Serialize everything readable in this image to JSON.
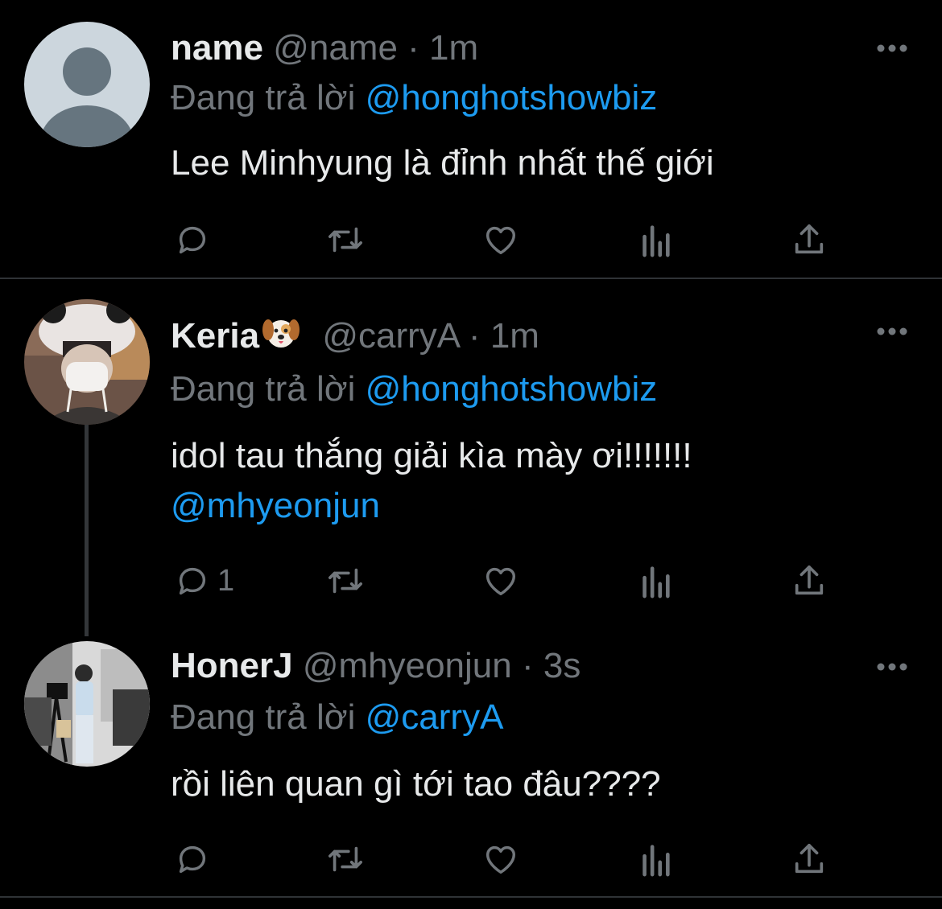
{
  "tweets": [
    {
      "name": "name",
      "handle": "@name",
      "time": "1m",
      "replying_label": "Đang trả lời",
      "replying_to": "@honghotshowbiz",
      "text": "Lee Minhyung là đỉnh nhất thế giới",
      "reply_count": ""
    },
    {
      "name": "Keria",
      "emoji": "dog-face-emoji",
      "handle": "@carryA",
      "time": "1m",
      "replying_label": "Đang trả lời",
      "replying_to": "@honghotshowbiz",
      "text": "idol tau thắng giải kìa mày ơi!!!!!!!",
      "text_mention": "@mhyeonjun",
      "reply_count": "1"
    },
    {
      "name": "HonerJ",
      "handle": "@mhyeonjun",
      "time": "3s",
      "replying_label": "Đang trả lời",
      "replying_to": "@carryA",
      "text": "rồi liên quan gì tới tao đâu????",
      "reply_count": ""
    }
  ],
  "separator": "·",
  "colors": {
    "background": "#000000",
    "text": "#e7e9ea",
    "secondary": "#71767b",
    "accent": "#1d9bf0",
    "divider": "#2f3336"
  },
  "icons": [
    "reply-icon",
    "retweet-icon",
    "like-icon",
    "views-icon",
    "share-icon",
    "more-icon"
  ]
}
